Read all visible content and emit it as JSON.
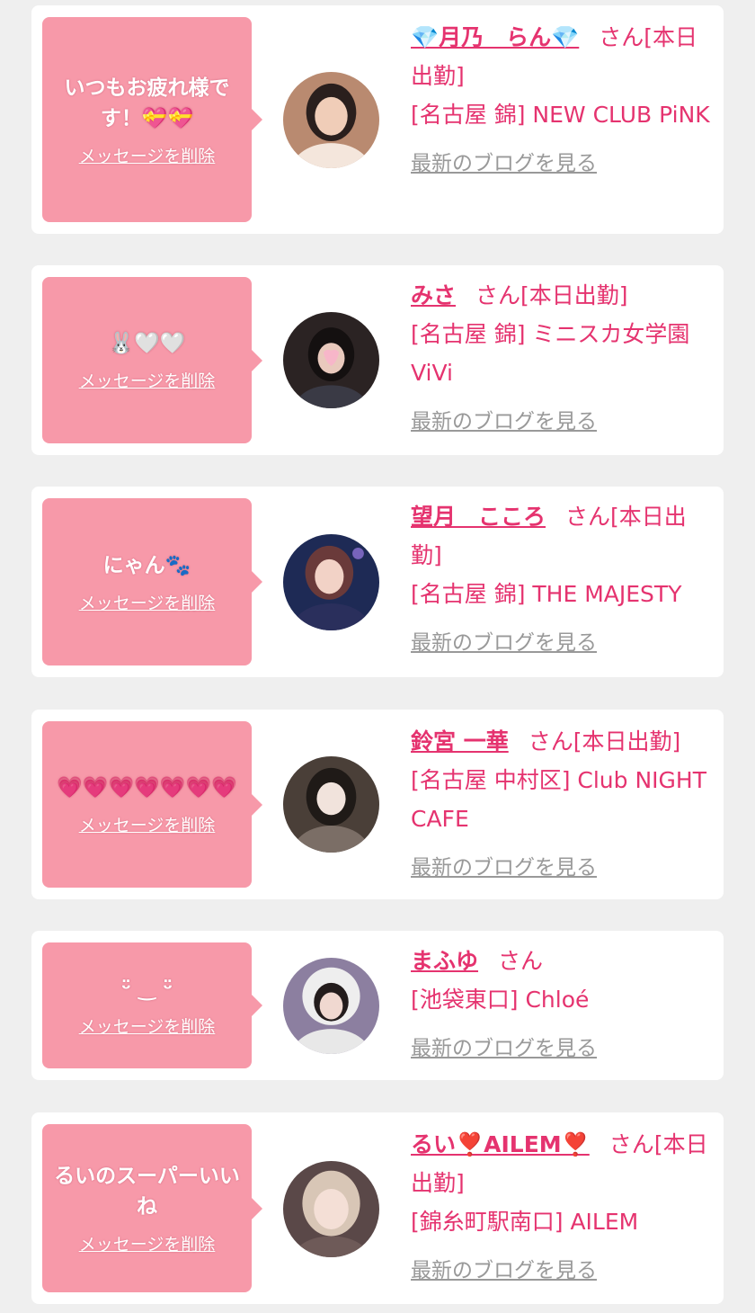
{
  "entries": [
    {
      "message": "いつもお疲れ様です！💝💝",
      "delete_label": "メッセージを削除",
      "name": "💎月乃　らん💎",
      "honorific": "さん",
      "status": "[本日出勤]",
      "shop": "[名古屋 錦] NEW CLUB PiNK",
      "blog_label": "最新のブログを見る",
      "avatar_icon": "profile-photo"
    },
    {
      "message": "🐰🤍🤍",
      "delete_label": "メッセージを削除",
      "name": "みさ",
      "honorific": "さん",
      "status": "[本日出勤]",
      "shop": "[名古屋 錦] ミニスカ女学園ViVi",
      "blog_label": "最新のブログを見る",
      "avatar_icon": "profile-photo"
    },
    {
      "message": "にゃん🐾",
      "delete_label": "メッセージを削除",
      "name": "望月　こころ",
      "honorific": "さん",
      "status": "[本日出勤]",
      "shop": "[名古屋 錦] THE MAJESTY",
      "blog_label": "最新のブログを見る",
      "avatar_icon": "profile-photo"
    },
    {
      "message": "💗💗💗💗💗💗💗",
      "delete_label": "メッセージを削除",
      "name": "鈴宮 一華",
      "honorific": "さん",
      "status": "[本日出勤]",
      "shop": "[名古屋 中村区] Club NIGHT CAFE",
      "blog_label": "最新のブログを見る",
      "avatar_icon": "profile-photo"
    },
    {
      "message": "ᵕ̈ ‿ ᵕ̈",
      "delete_label": "メッセージを削除",
      "name": "まふゆ",
      "honorific": "さん",
      "status": "",
      "shop": "[池袋東口] Chloé",
      "blog_label": "最新のブログを見る",
      "avatar_icon": "profile-photo"
    },
    {
      "message": "るいのスーパーいいね",
      "delete_label": "メッセージを削除",
      "name": "るい❣️AILEM❣️",
      "honorific": "さん",
      "status": "[本日出勤]",
      "shop": "[錦糸町駅南口] AILEM",
      "blog_label": "最新のブログを見る",
      "avatar_icon": "profile-photo"
    }
  ],
  "colors": {
    "accent": "#e5336f",
    "bubble": "#f799a9",
    "muted": "#999999",
    "card": "#ffffff",
    "background": "#efefef"
  }
}
